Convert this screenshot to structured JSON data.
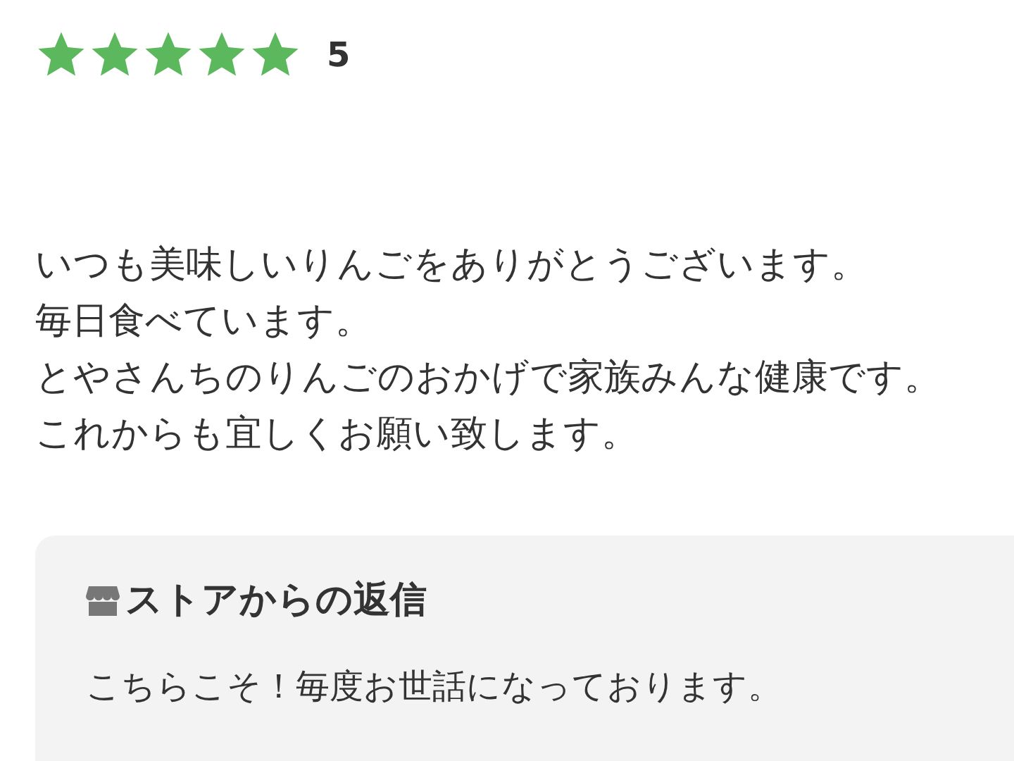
{
  "rating": {
    "stars": 5,
    "score": "5"
  },
  "review": {
    "lines": [
      "いつも美味しいりんごをありがとうございます。",
      "毎日食べています。",
      "とやさんちのりんごのおかげで家族みんな健康です。",
      "これからも宜しくお願い致します。"
    ]
  },
  "store_reply": {
    "title": "ストアからの返信",
    "text": "こちらこそ！毎度お世話になっております。"
  }
}
